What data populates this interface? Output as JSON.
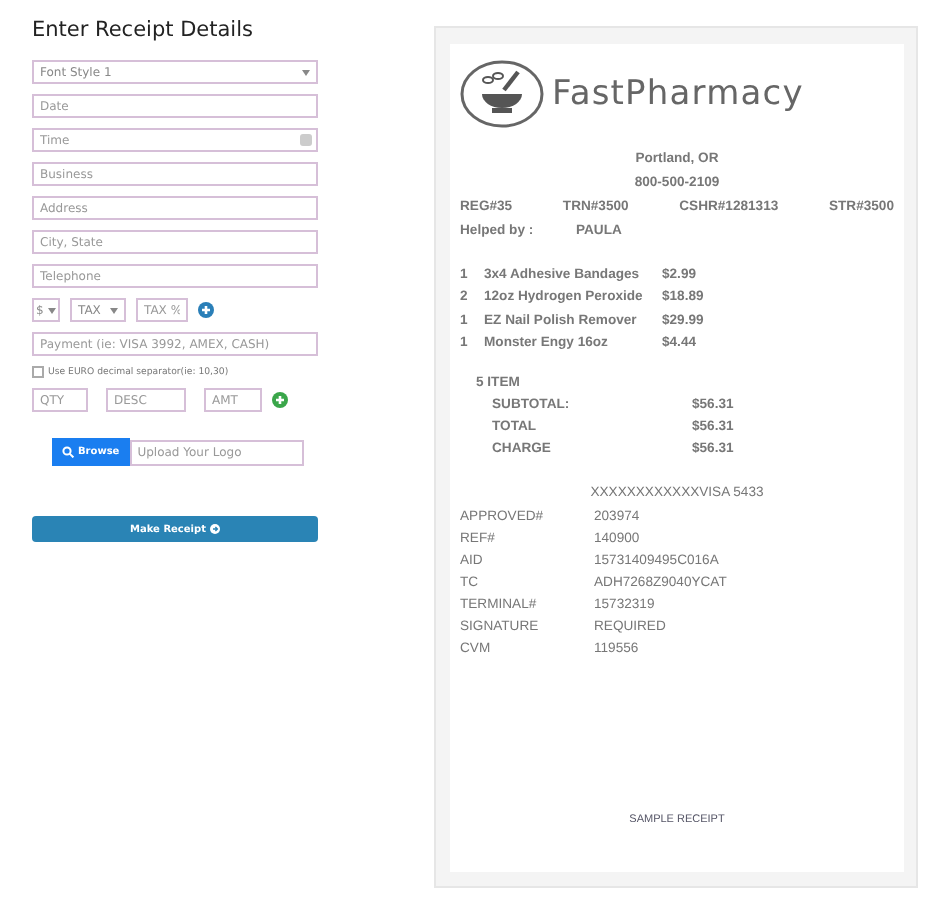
{
  "form": {
    "title": "Enter Receipt Details",
    "fields": [
      {
        "kind": "select",
        "value": "Font Style 1"
      },
      {
        "kind": "text",
        "placeholder": "Date"
      },
      {
        "kind": "time",
        "placeholder": "Time"
      },
      {
        "kind": "text",
        "placeholder": "Business"
      },
      {
        "kind": "text",
        "placeholder": "Address"
      },
      {
        "kind": "text",
        "placeholder": "City, State"
      },
      {
        "kind": "text",
        "placeholder": "Telephone"
      }
    ],
    "currency": "$",
    "tax_type": "TAX",
    "tax_percent": {
      "placeholder": "TAX %"
    },
    "payment": {
      "placeholder": "Payment (ie: VISA 3992, AMEX, CASH)"
    },
    "euro_separator": {
      "label": "Use EURO decimal separator(ie: 10,30)",
      "checked": false
    },
    "line_item": {
      "qty": {
        "placeholder": "QTY"
      },
      "desc": {
        "placeholder": "DESC"
      },
      "amt": {
        "placeholder": "AMT"
      }
    },
    "browse_button": "Browse",
    "logo_field": {
      "placeholder": "Upload Your Logo"
    },
    "make_button": "Make Receipt"
  },
  "receipt": {
    "brand": "FastPharmacy",
    "header_lines": [
      "Portland, OR",
      "800-500-2109"
    ],
    "ids": [
      "REG#35",
      "TRN#3500",
      "CSHR#1281313",
      "STR#3500"
    ],
    "helped_by": {
      "label": "Helped by :",
      "value": "PAULA"
    },
    "items": [
      {
        "qty": "1",
        "name": "3x4 Adhesive Bandages",
        "price": "$2.99"
      },
      {
        "qty": "2",
        "name": "12oz Hydrogen Peroxide",
        "price": "$18.89"
      },
      {
        "qty": "1",
        "name": "EZ Nail Polish Remover",
        "price": "$29.99"
      },
      {
        "qty": "1",
        "name": "Monster Engy 16oz",
        "price": "$4.44"
      }
    ],
    "item_count": "5 ITEM",
    "totals": [
      {
        "label": "SUBTOTAL:",
        "value": "$56.31"
      },
      {
        "label": "TOTAL",
        "value": "$56.31"
      },
      {
        "label": "CHARGE",
        "value": "$56.31"
      }
    ],
    "card": "XXXXXXXXXXXXVISA 5433",
    "details": [
      {
        "label": "APPROVED#",
        "value": "203974"
      },
      {
        "label": "REF#",
        "value": "140900"
      },
      {
        "label": "AID",
        "value": "15731409495C016A"
      },
      {
        "label": "TC",
        "value": "ADH7268Z9040YCAT"
      },
      {
        "label": "TERMINAL#",
        "value": "15732319"
      },
      {
        "label": "SIGNATURE",
        "value": "REQUIRED"
      },
      {
        "label": "CVM",
        "value": "119556"
      }
    ],
    "footer": "SAMPLE RECEIPT"
  }
}
